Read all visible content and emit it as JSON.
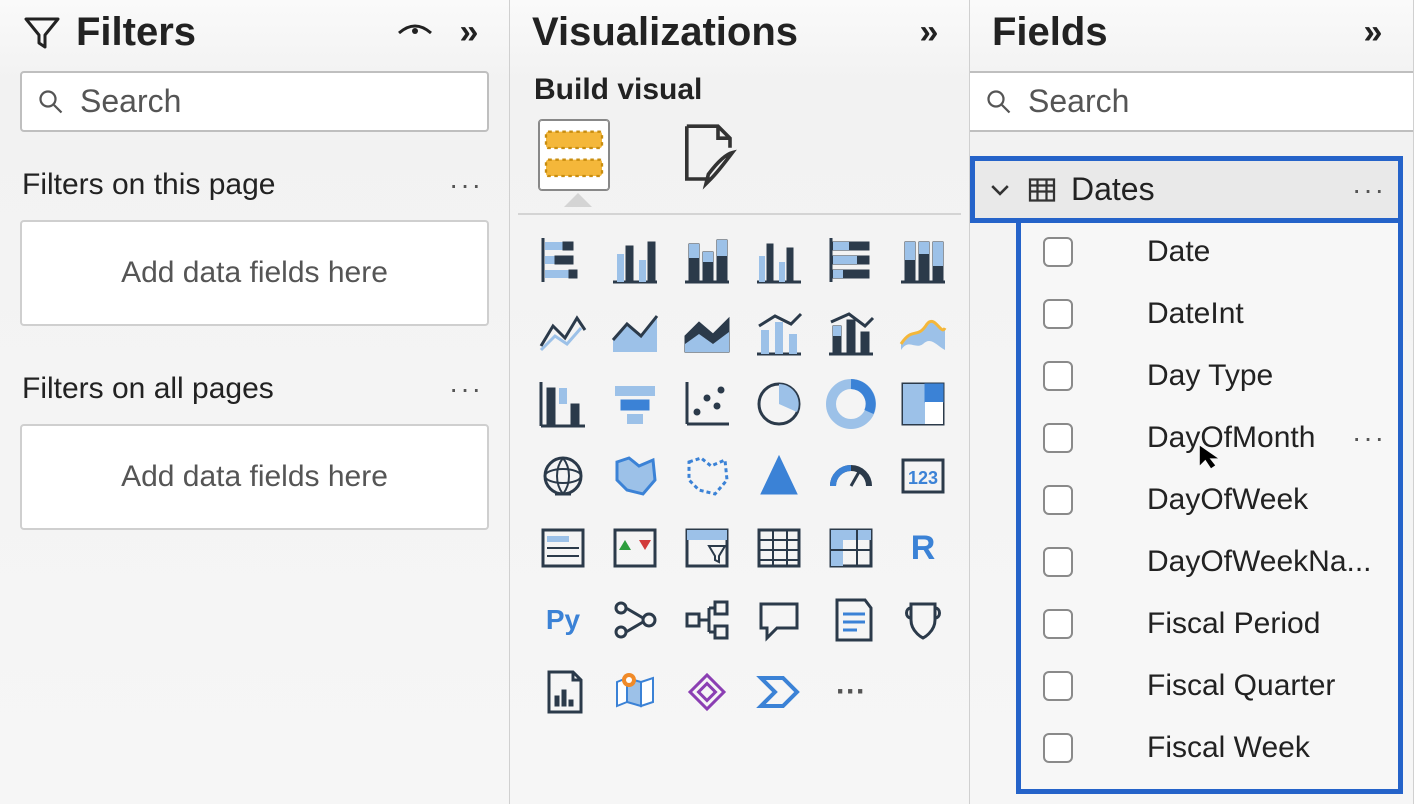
{
  "filters": {
    "title": "Filters",
    "search_placeholder": "Search",
    "page_section": "Filters on this page",
    "allpages_section": "Filters on all pages",
    "drop_text": "Add data fields here"
  },
  "visuals": {
    "title": "Visualizations",
    "build_label": "Build visual",
    "icons": [
      "stacked-bar",
      "clustered-bar",
      "stacked-column",
      "clustered-column",
      "stacked-bar-100",
      "stacked-column-100",
      "line",
      "area",
      "stacked-area",
      "line-clustered-column",
      "line-stacked-column",
      "ribbon",
      "waterfall",
      "funnel",
      "scatter",
      "pie",
      "donut",
      "treemap",
      "map",
      "filled-map",
      "shape-map",
      "azure-map",
      "gauge",
      "card",
      "multi-row-card",
      "kpi",
      "slicer",
      "table",
      "matrix",
      "r-visual",
      "py-visual",
      "key-influencers",
      "decomposition-tree",
      "qna",
      "smart-narrative",
      "goals",
      "paginated-report",
      "arcgis",
      "power-apps",
      "power-automate",
      "more-visuals"
    ],
    "r_label": "R",
    "py_label": "Py",
    "card_label": "123",
    "more_label": "···"
  },
  "fields": {
    "title": "Fields",
    "search_placeholder": "Search",
    "table_name": "Dates",
    "items": [
      {
        "label": "Date",
        "more": false
      },
      {
        "label": "DateInt",
        "more": false
      },
      {
        "label": "Day Type",
        "more": false
      },
      {
        "label": "DayOfMonth",
        "more": true
      },
      {
        "label": "DayOfWeek",
        "more": false
      },
      {
        "label": "DayOfWeekNa...",
        "more": false
      },
      {
        "label": "Fiscal Period",
        "more": false
      },
      {
        "label": "Fiscal Quarter",
        "more": false
      },
      {
        "label": "Fiscal Week",
        "more": false
      }
    ]
  }
}
